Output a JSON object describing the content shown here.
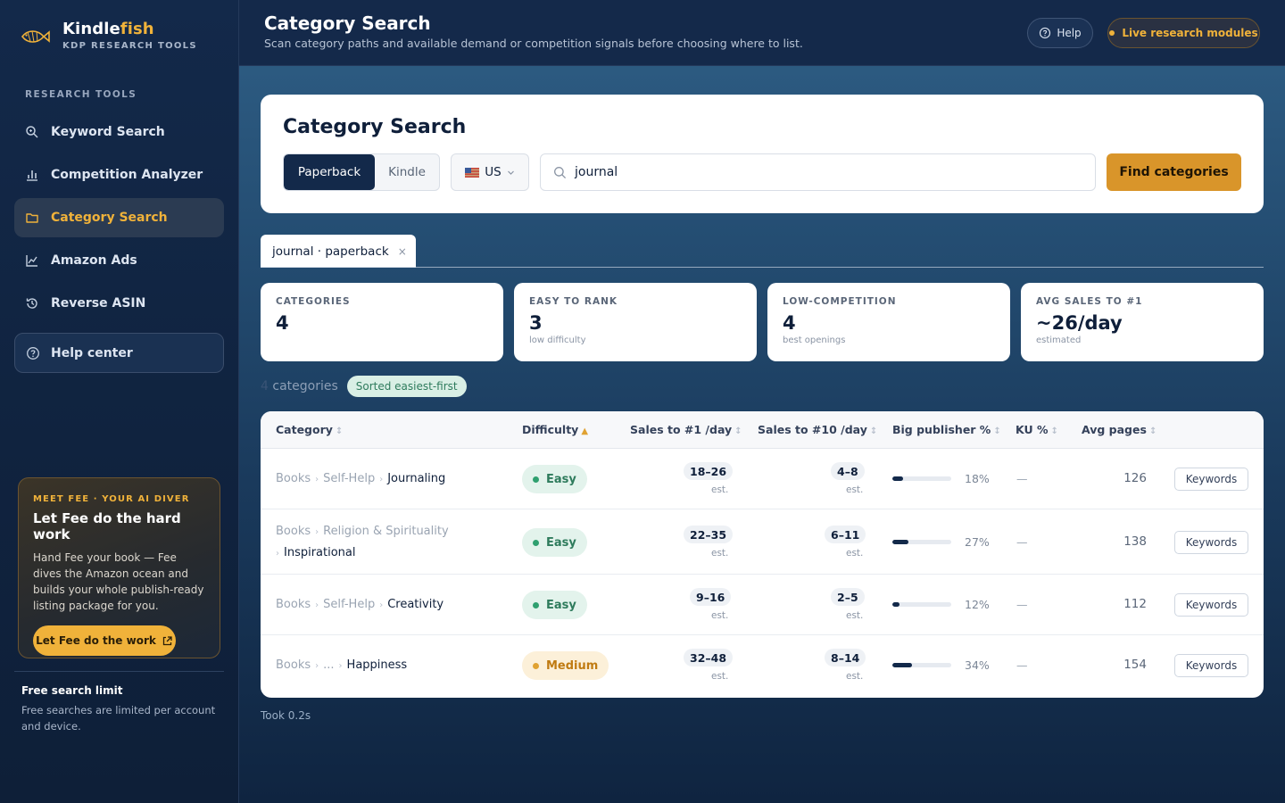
{
  "brand": {
    "name_main": "Kindle",
    "name_accent": "fish",
    "subtitle": "KDP RESEARCH TOOLS"
  },
  "sidebar": {
    "section_label": "RESEARCH TOOLS",
    "items": [
      {
        "label": "Keyword Search",
        "icon": "search-icon"
      },
      {
        "label": "Competition Analyzer",
        "icon": "bar-chart-icon"
      },
      {
        "label": "Category Search",
        "icon": "folder-icon",
        "active": true
      },
      {
        "label": "Amazon Ads",
        "icon": "line-chart-icon"
      },
      {
        "label": "Reverse ASIN",
        "icon": "history-icon"
      }
    ],
    "help_center": "Help center",
    "fee": {
      "kicker": "MEET FEE · YOUR AI DIVER",
      "title": "Let Fee do the hard work",
      "desc": "Hand Fee your book — Fee dives the Amazon ocean and builds your whole publish-ready listing package for you.",
      "button": "Let Fee do the work"
    },
    "limit": {
      "title": "Free search limit",
      "desc": "Free searches are limited per account and device."
    }
  },
  "header": {
    "title": "Category Search",
    "subtitle": "Scan category paths and available demand or competition signals before choosing where to list.",
    "help_label": "Help",
    "live_label": "Live research modules"
  },
  "search": {
    "title": "Category Search",
    "formats": [
      "Paperback",
      "Kindle"
    ],
    "selected_format": "Paperback",
    "market": "US",
    "query": "journal",
    "button": "Find categories"
  },
  "tab": {
    "label": "journal · paperback",
    "close": "×"
  },
  "stats": [
    {
      "label": "CATEGORIES",
      "value": "4",
      "sub": ""
    },
    {
      "label": "EASY TO RANK",
      "value": "3",
      "sub": "low difficulty"
    },
    {
      "label": "LOW-COMPETITION",
      "value": "4",
      "sub": "best openings"
    },
    {
      "label": "AVG SALES TO #1",
      "value": "~26/day",
      "sub": "estimated"
    }
  ],
  "results": {
    "count": "4",
    "count_label": "categories",
    "sorted": "Sorted easiest-first"
  },
  "table": {
    "columns": [
      "Category",
      "Difficulty",
      "Sales to #1 /day",
      "Sales to #10 /day",
      "Big publisher %",
      "KU %",
      "Avg pages"
    ],
    "est_label": "est.",
    "keywords_label": "Keywords",
    "rows": [
      {
        "path": [
          "Books",
          "Self-Help"
        ],
        "leaf": "Journaling",
        "difficulty": "Easy",
        "level": "easy",
        "s1": "18–26",
        "s10": "4–8",
        "big_pub": "18%",
        "big_pub_frac": 0.18,
        "ku": "—",
        "pages": "126"
      },
      {
        "path": [
          "Books",
          "Religion & Spirituality"
        ],
        "leaf": "Inspirational",
        "difficulty": "Easy",
        "level": "easy",
        "s1": "22–35",
        "s10": "6–11",
        "big_pub": "27%",
        "big_pub_frac": 0.27,
        "ku": "—",
        "pages": "138"
      },
      {
        "path": [
          "Books",
          "Self-Help"
        ],
        "leaf": "Creativity",
        "difficulty": "Easy",
        "level": "easy",
        "s1": "9–16",
        "s10": "2–5",
        "big_pub": "12%",
        "big_pub_frac": 0.12,
        "ku": "—",
        "pages": "112"
      },
      {
        "path": [
          "Books",
          "..."
        ],
        "leaf": "Happiness",
        "difficulty": "Medium",
        "level": "medium",
        "s1": "32–48",
        "s10": "8–14",
        "big_pub": "34%",
        "big_pub_frac": 0.34,
        "ku": "—",
        "pages": "154"
      }
    ]
  },
  "footer": {
    "took": "Took 0.2s"
  },
  "colors": {
    "accent": "#f0b23a",
    "navy": "#13294a",
    "easy": "#2fa06f",
    "medium": "#e0a232"
  }
}
